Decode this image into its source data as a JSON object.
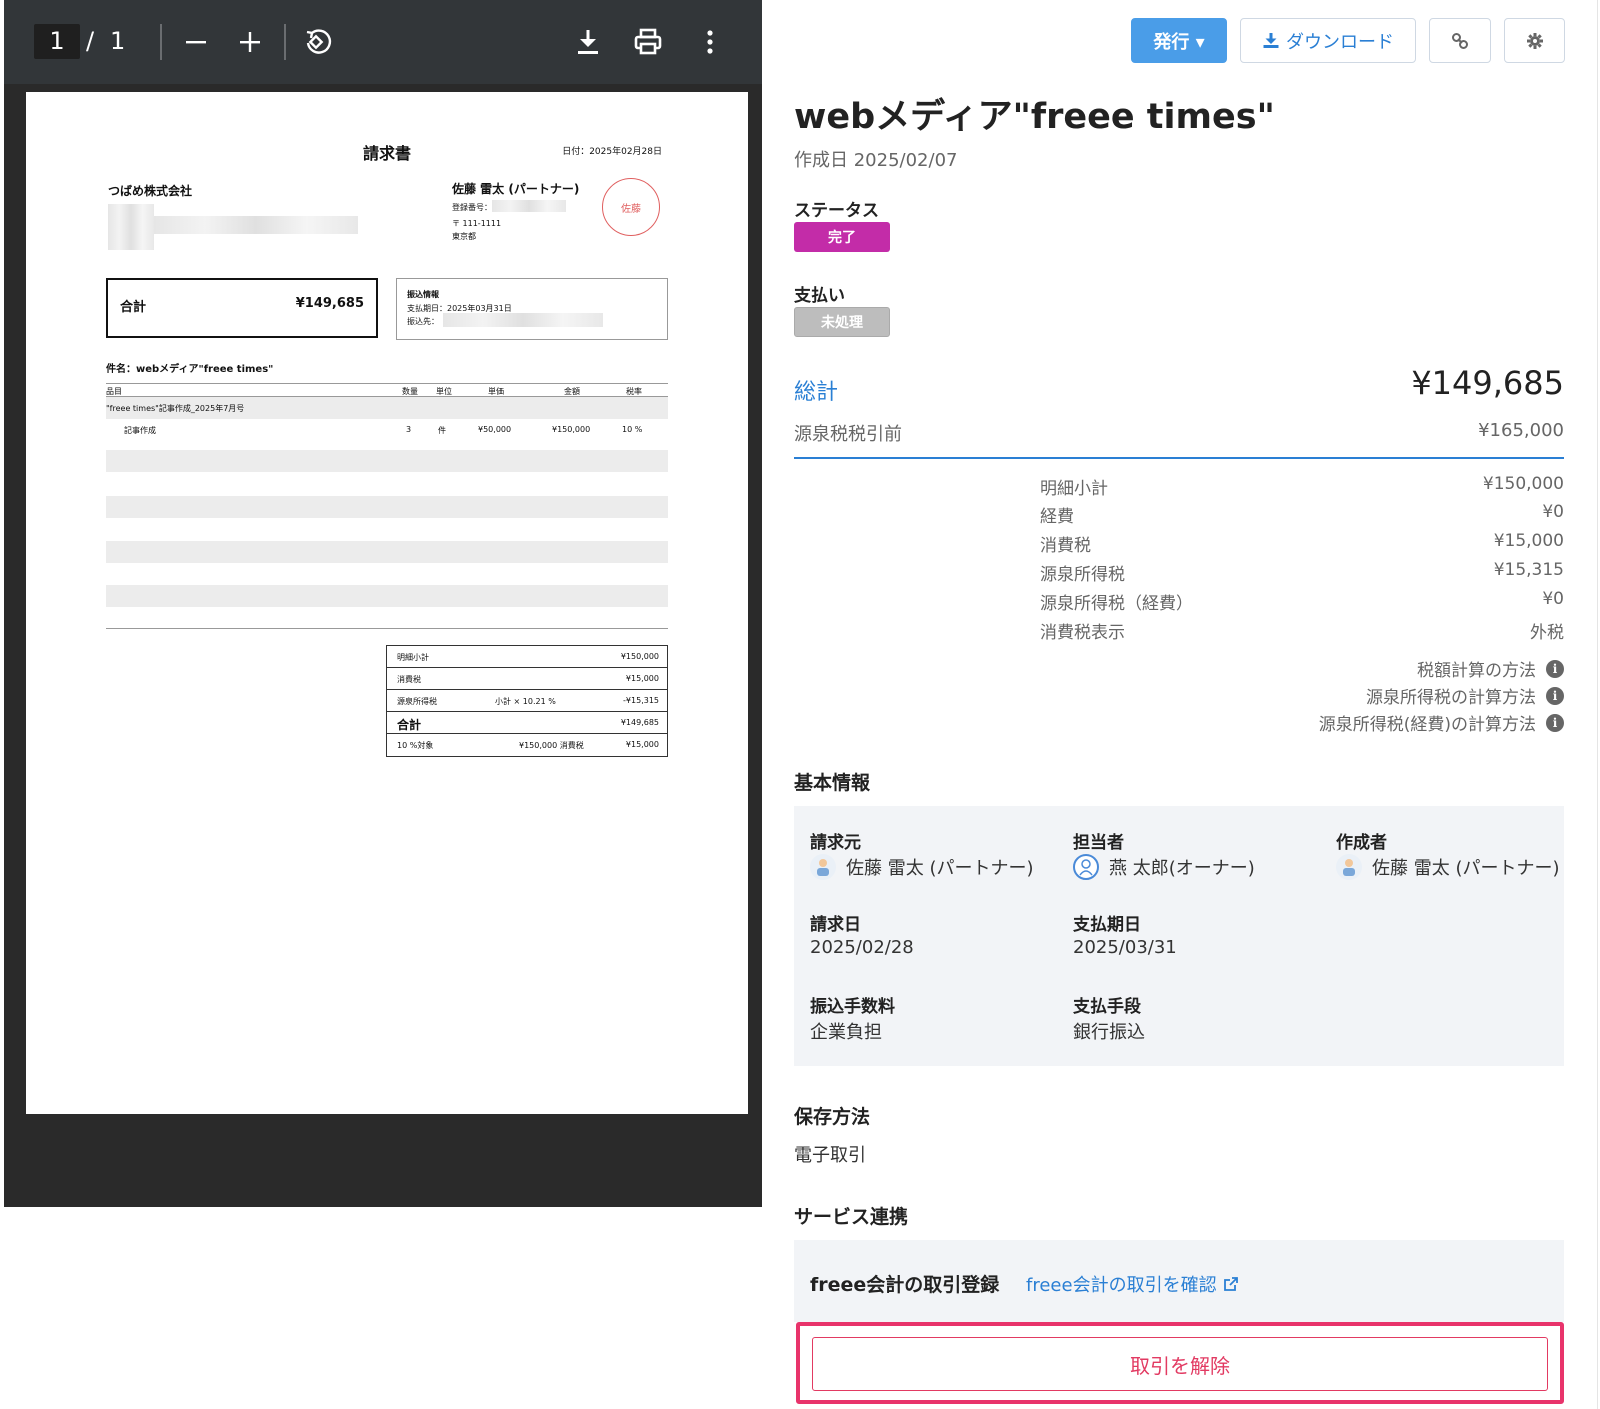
{
  "viewer": {
    "page_current": "1",
    "page_sep": "/",
    "page_total": "1",
    "icons": [
      "zoom-out-icon",
      "zoom-in-icon",
      "rotate-icon",
      "download-icon",
      "print-icon",
      "more-vert-icon"
    ]
  },
  "document": {
    "title": "請求書",
    "date": "日付：2025年02月28日",
    "client": "つばめ株式会社",
    "issuer_name": "佐藤 雷太 (パートナー)",
    "issuer_reg": "登録番号：",
    "issuer_postal": "〒 111-1111",
    "issuer_pref": "東京都",
    "stamp": "佐藤",
    "total_label": "合計",
    "total_value": "¥149,685",
    "bank_title": "振込情報",
    "bank_due": "支払期日：2025年03月31日",
    "bank_to": "振込先：",
    "subject": "件名：webメディア\"freee times\"",
    "item_headers": {
      "name": "品目",
      "qty": "数量",
      "unit": "単位",
      "price": "単価",
      "amount": "金額",
      "tax": "税率"
    },
    "group_row": "\"freee times\"記事作成_2025年7月号",
    "item": {
      "name": "記事作成",
      "qty": "3",
      "unit": "件",
      "price": "¥50,000",
      "amount": "¥150,000",
      "tax": "10 %"
    },
    "summary": {
      "subtotal_label": "明細小計",
      "subtotal_value": "¥150,000",
      "tax_label": "消費税",
      "tax_value": "¥15,000",
      "wh_label": "源泉所得税",
      "wh_mid": "小計 × 10.21 %",
      "wh_value": "-¥15,315",
      "total_label": "合計",
      "total_value": "¥149,685",
      "rate_label": "10 %対象",
      "rate_mid": "¥150,000 消費税",
      "rate_value": "¥15,000"
    }
  },
  "topbar": {
    "issue_label": "発行 ▾",
    "download_label": "ダウンロード"
  },
  "header": {
    "title": "webメディア\"freee times\"",
    "created": "作成日 2025/02/07"
  },
  "status": {
    "label": "ステータス",
    "badge": "完了",
    "color": "#c32ca8"
  },
  "payment": {
    "label": "支払い",
    "badge": "未処理"
  },
  "totals": {
    "total_label": "総計",
    "total_value": "¥149,685",
    "pre_label": "源泉税税引前",
    "pre_value": "¥165,000",
    "breakdown": [
      {
        "label": "明細小計",
        "value": "¥150,000"
      },
      {
        "label": "経費",
        "value": "¥0"
      },
      {
        "label": "消費税",
        "value": "¥15,000"
      },
      {
        "label": "源泉所得税",
        "value": "¥15,315"
      },
      {
        "label": "源泉所得税（経費）",
        "value": "¥0"
      },
      {
        "label": "消費税表示",
        "value": "外税"
      }
    ],
    "help_links": [
      "税額計算の方法",
      "源泉所得税の計算方法",
      "源泉所得税(経費)の計算方法"
    ]
  },
  "basic": {
    "heading": "基本情報",
    "billing_from_label": "請求元",
    "billing_from_value": "佐藤 雷太 (パートナー)",
    "assignee_label": "担当者",
    "assignee_value": "燕 太郎(オーナー)",
    "creator_label": "作成者",
    "creator_value": "佐藤 雷太 (パートナー)",
    "invoice_date_label": "請求日",
    "invoice_date_value": "2025/02/28",
    "due_date_label": "支払期日",
    "due_date_value": "2025/03/31",
    "fee_label": "振込手数料",
    "fee_value": "企業負担",
    "method_label": "支払手段",
    "method_value": "銀行振込"
  },
  "storage": {
    "heading": "保存方法",
    "value": "電子取引"
  },
  "service": {
    "heading": "サービス連携",
    "title": "freee会計の取引登録",
    "link": "freee会計の取引を確認",
    "unlink": "取引を解除"
  },
  "colors": {
    "accent": "#2a7fd4",
    "highlight": "#e8336b",
    "danger": "#e23a62"
  }
}
